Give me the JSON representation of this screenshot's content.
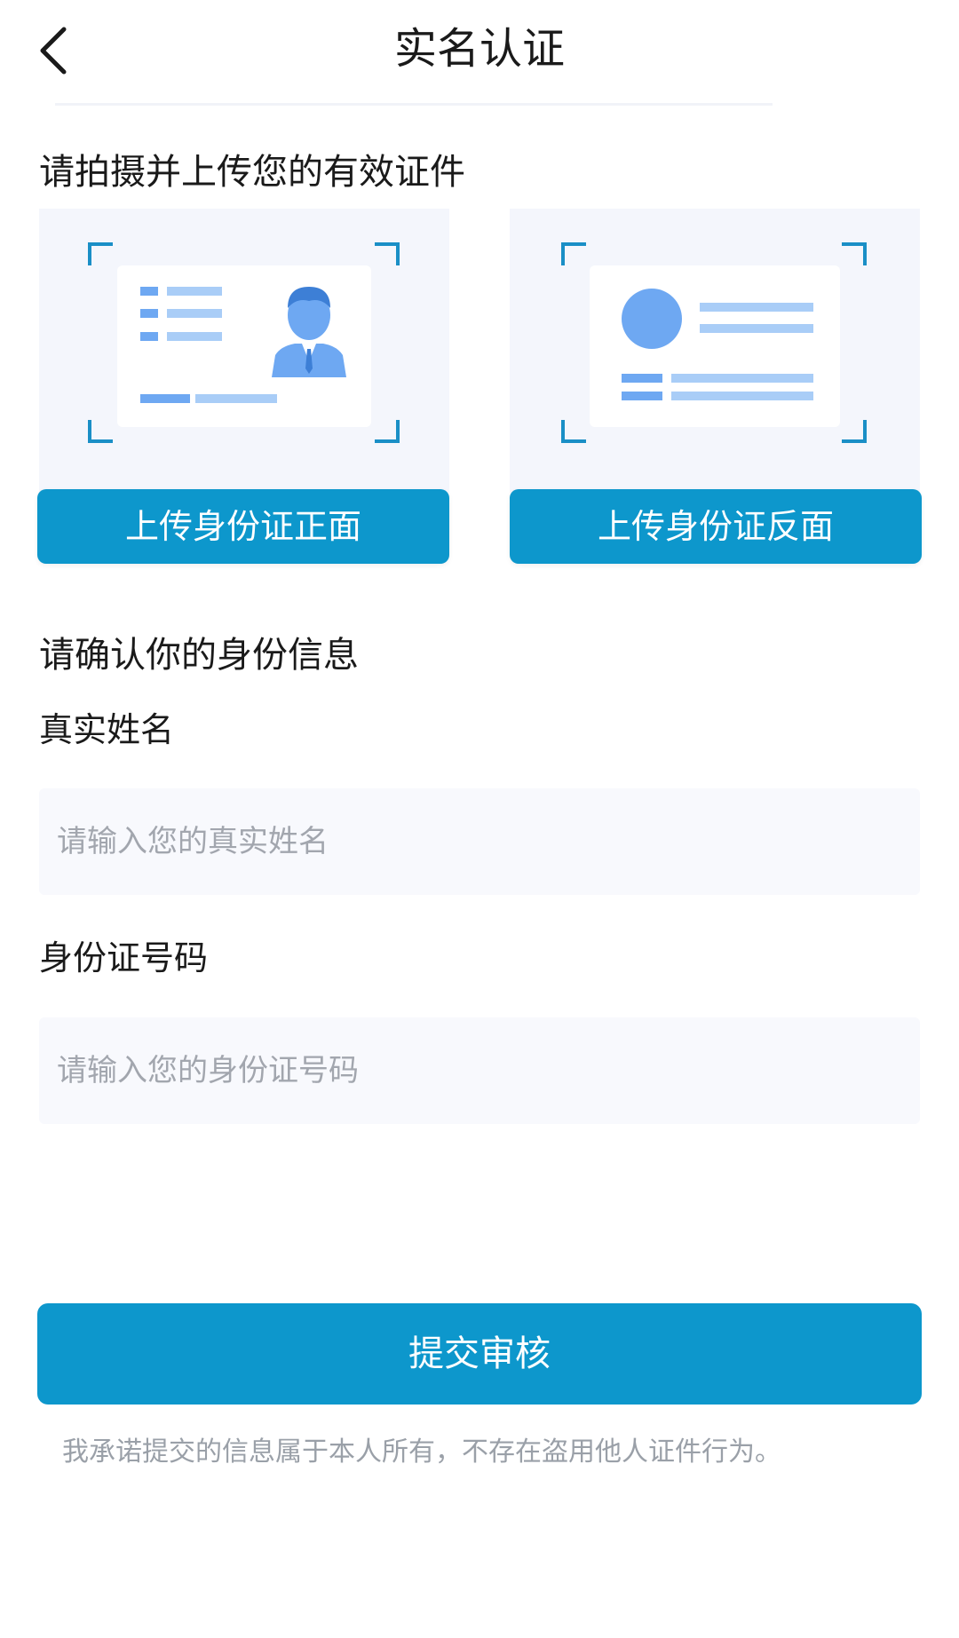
{
  "header": {
    "title": "实名认证",
    "back_icon": "chevron-left-icon"
  },
  "upload": {
    "heading": "请拍摄并上传您的有效证件",
    "front_button": "上传身份证正面",
    "back_button": "上传身份证反面"
  },
  "identity": {
    "heading": "请确认你的身份信息",
    "name_label": "真实姓名",
    "name_placeholder": "请输入您的真实姓名",
    "name_value": "",
    "id_label": "身份证号码",
    "id_placeholder": "请输入您的身份证号码",
    "id_value": ""
  },
  "submit": {
    "label": "提交审核"
  },
  "disclaimer": "我承诺提交的信息属于本人所有，不存在盗用他人证件行为。",
  "colors": {
    "primary": "#0d97cc",
    "card_bg": "#f4f6fc",
    "frame": "#1a8fc6",
    "illus": "#6ea8f2"
  }
}
